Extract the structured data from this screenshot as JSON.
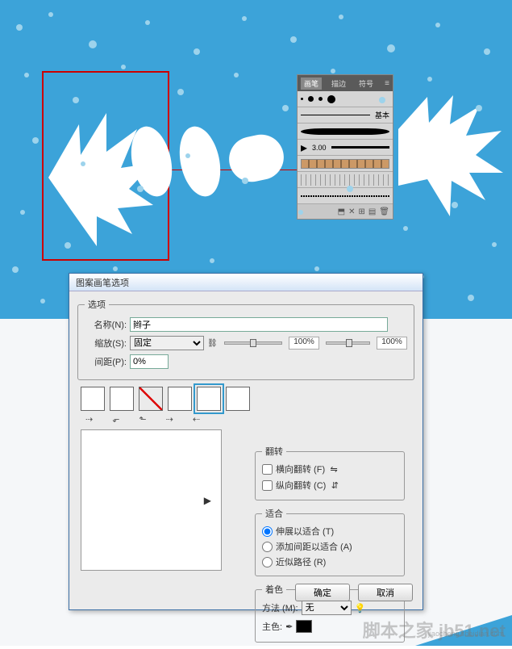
{
  "canvas": {
    "bg": "#3ca3d9"
  },
  "palette": {
    "tabs": {
      "brush": "画笔",
      "stroke": "描边",
      "symbol": "符号"
    },
    "basic_label": "基本",
    "size_value": "3.00"
  },
  "dialog": {
    "title": "图案画笔选项",
    "options_legend": "选项",
    "name_label": "名称(N):",
    "name_value": "辫子",
    "scale_label": "缩放(S):",
    "scale_mode": "固定",
    "scale_pct1": "100%",
    "scale_pct2": "100%",
    "spacing_label": "间距(P):",
    "spacing_value": "0%",
    "flip_legend": "翻转",
    "flip_h": "横向翻转 (F)",
    "flip_v": "纵向翻转 (C)",
    "fit_legend": "适合",
    "fit_stretch": "伸展以适合 (T)",
    "fit_space": "添加间距以适合 (A)",
    "fit_approx": "近似路径 (R)",
    "color_legend": "着色",
    "method_label": "方法 (M):",
    "method_value": "无",
    "keycolor_label": "主色:",
    "ok": "确定",
    "cancel": "取消"
  },
  "watermark": {
    "main": "脚本之家 jb51.net",
    "sub": "jiaocheng.sheidian.com"
  }
}
